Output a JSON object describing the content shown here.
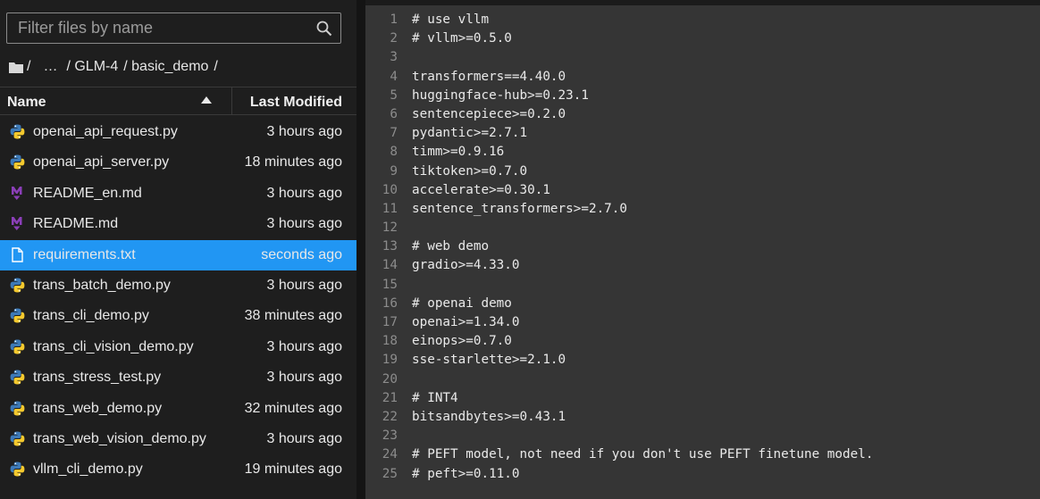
{
  "search": {
    "placeholder": "Filter files by name",
    "icon": "search-icon"
  },
  "breadcrumb": {
    "root": "/",
    "ellipsis": "…",
    "parts": [
      "/ GLM-4",
      "/ basic_demo",
      "/"
    ]
  },
  "table": {
    "col_name": "Name",
    "col_modified": "Last Modified",
    "rows": [
      {
        "name": "openai_api_request.py",
        "modified": "3 hours ago",
        "type": "python"
      },
      {
        "name": "openai_api_server.py",
        "modified": "18 minutes ago",
        "type": "python"
      },
      {
        "name": "README_en.md",
        "modified": "3 hours ago",
        "type": "markdown"
      },
      {
        "name": "README.md",
        "modified": "3 hours ago",
        "type": "markdown"
      },
      {
        "name": "requirements.txt",
        "modified": "seconds ago",
        "type": "text",
        "selected": true
      },
      {
        "name": "trans_batch_demo.py",
        "modified": "3 hours ago",
        "type": "python"
      },
      {
        "name": "trans_cli_demo.py",
        "modified": "38 minutes ago",
        "type": "python"
      },
      {
        "name": "trans_cli_vision_demo.py",
        "modified": "3 hours ago",
        "type": "python"
      },
      {
        "name": "trans_stress_test.py",
        "modified": "3 hours ago",
        "type": "python"
      },
      {
        "name": "trans_web_demo.py",
        "modified": "32 minutes ago",
        "type": "python"
      },
      {
        "name": "trans_web_vision_demo.py",
        "modified": "3 hours ago",
        "type": "python"
      },
      {
        "name": "vllm_cli_demo.py",
        "modified": "19 minutes ago",
        "type": "python"
      }
    ]
  },
  "editor": {
    "lines": [
      "# use vllm",
      "# vllm>=0.5.0",
      "",
      "transformers==4.40.0",
      "huggingface-hub>=0.23.1",
      "sentencepiece>=0.2.0",
      "pydantic>=2.7.1",
      "timm>=0.9.16",
      "tiktoken>=0.7.0",
      "accelerate>=0.30.1",
      "sentence_transformers>=2.7.0",
      "",
      "# web demo",
      "gradio>=4.33.0",
      "",
      "# openai demo",
      "openai>=1.34.0",
      "einops>=0.7.0",
      "sse-starlette>=2.1.0",
      "",
      "# INT4",
      "bitsandbytes>=0.43.1",
      "",
      "# PEFT model, not need if you don't use PEFT finetune model.",
      "# peft>=0.11.0"
    ]
  },
  "colors": {
    "selected": "#2196f3",
    "python_blue": "#3572A5",
    "python_yellow": "#FFD43B",
    "markdown": "#7e3fb3"
  }
}
